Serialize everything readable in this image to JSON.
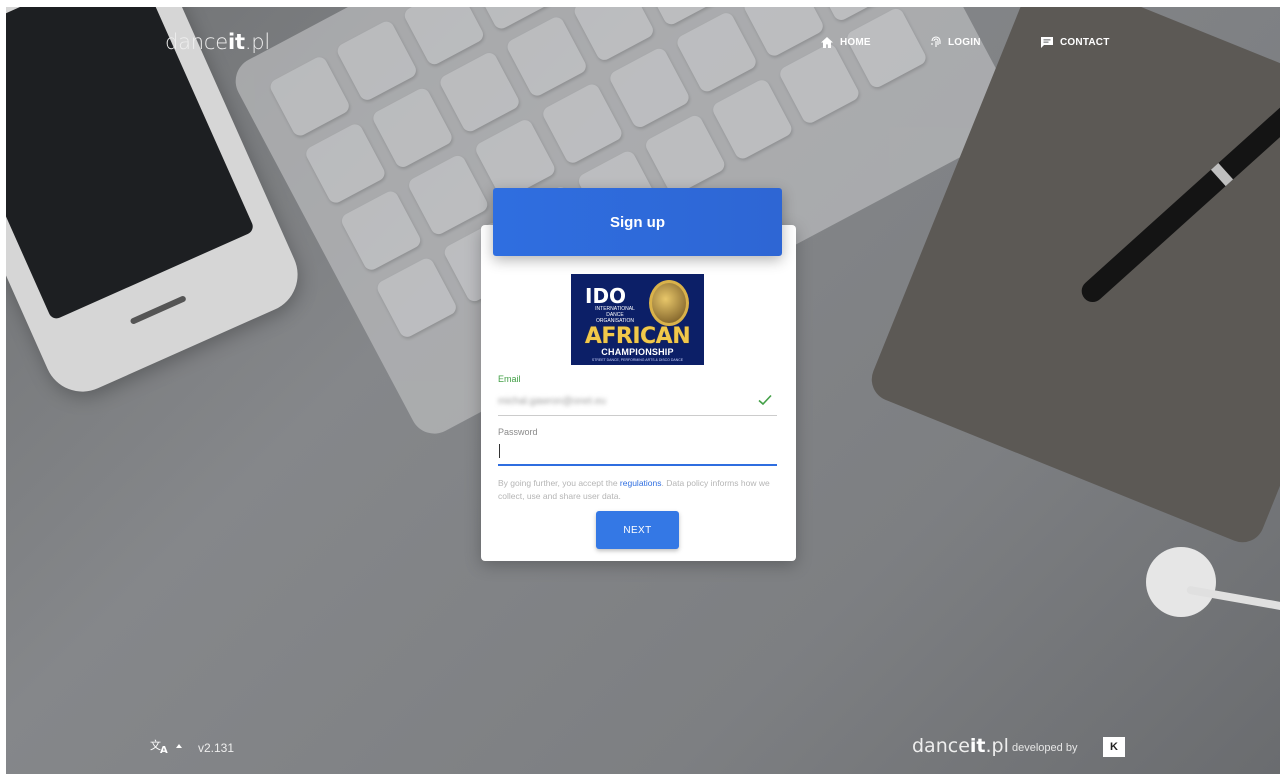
{
  "header": {
    "brand_prefix": "dance",
    "brand_bold": "it",
    "brand_suffix": ".pl",
    "nav": [
      {
        "label": "HOME",
        "icon": "home-icon"
      },
      {
        "label": "LOGIN",
        "icon": "fingerprint-icon"
      },
      {
        "label": "CONTACT",
        "icon": "chat-icon"
      }
    ]
  },
  "signup": {
    "title": "Sign up",
    "logo": {
      "ido": "IDO",
      "ido_sub": "INTERNATIONAL DANCE ORGANISATION",
      "headline": "AFRICAN",
      "sub": "CHAMPIONSHIP",
      "tagline": "STREET DANCE, PERFORMING ARTS & DISCO DANCE"
    },
    "email_label": "Email",
    "email_value": "michal.gawron@onet.eu",
    "password_label": "Password",
    "terms_before": "By going further, you accept the ",
    "terms_link": "regulations",
    "terms_after": ". Data policy informs how we collect, use and share user data.",
    "next_label": "NEXT"
  },
  "footer": {
    "version": "v2.131",
    "brand_prefix": "dance",
    "brand_bold": "it",
    "brand_suffix": ".pl",
    "developed_by": "developed by",
    "dev_logo": "K"
  },
  "colors": {
    "accent": "#2f6ee0",
    "valid": "#43a047"
  }
}
